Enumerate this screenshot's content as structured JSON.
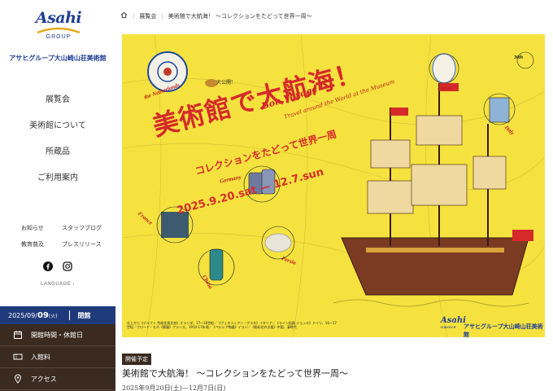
{
  "brand": {
    "logo_word": "Asahi",
    "logo_group": "GROUP",
    "museum_name": "アサヒグループ大山崎山荘美術館",
    "accent_color": "#1f3f95"
  },
  "nav_main": [
    {
      "label": "展覧会"
    },
    {
      "label": "美術館について"
    },
    {
      "label": "所蔵品"
    },
    {
      "label": "ご利用案内"
    }
  ],
  "nav_sub": [
    {
      "label": "お知らせ"
    },
    {
      "label": "スタッフブログ"
    },
    {
      "label": "教育普及"
    },
    {
      "label": "プレスリリース"
    }
  ],
  "social": {
    "icons": [
      "facebook-icon",
      "instagram-icon"
    ]
  },
  "language": {
    "label": "LANGUAGE ›"
  },
  "today": {
    "date": "2025/09/",
    "day": "09",
    "weekday": "(火)",
    "status": "閉館"
  },
  "utility_nav": [
    {
      "label": "開館時間・休館日",
      "icon": "calendar-icon"
    },
    {
      "label": "入館料",
      "icon": "ticket-icon"
    },
    {
      "label": "アクセス",
      "icon": "location-icon"
    }
  ],
  "breadcrumb": {
    "home_icon": "home-icon",
    "items": [
      "展覧会",
      "美術館で大航海！ ～コレクションをたどって世界一周～"
    ]
  },
  "hero": {
    "title": "美術館で大航海！",
    "subtitle": "コレクションをたどって世界一周",
    "dates": "2025.9.20.sat — 12.7.sun",
    "bon_voyage": "Bon Voyage !",
    "travel": "Travel around the World at the Museum",
    "countries": [
      "the Netherlands",
      "Japan",
      "Italy",
      "Germany",
      "France",
      "Persia",
      "China"
    ],
    "anniversary": "30th",
    "kanban": "大公開!",
    "logo_word": "Asahi",
    "logo_group": "GROUP",
    "logo_name": "アサヒグループ大山崎山荘美術館",
    "credit": "左上から《デルフト 色絵花鳥文皿》オランダ、17〜18世紀／《ヴェネツィアン・グラス》イタリア／《ライン炻器 ジョッキ》ドイツ、16〜17世紀／クロード・モネ《睡蓮》フランス、1914-17年頃／《ペルシア陶器》イラン／《粉彩花卉文瓶》中国、清時代"
  },
  "exhibition": {
    "tag": "開催予定",
    "title": "美術館で大航海！ ～コレクションをたどって世界一周～",
    "dates": "2025年9月20日(土)—12月7日(日)"
  }
}
